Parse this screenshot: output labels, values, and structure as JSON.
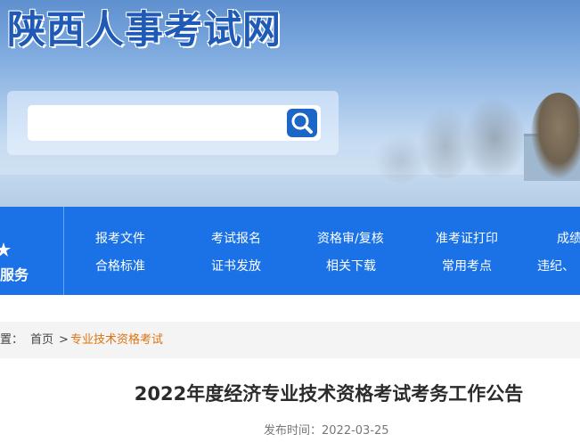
{
  "site": {
    "logo_text": "陕西人事考试网"
  },
  "search": {
    "placeholder": "",
    "button_icon": "magnifier-icon"
  },
  "nav": {
    "left_label": "服务",
    "row1": [
      "报考文件",
      "考试报名",
      "资格审/复核",
      "准考证打印",
      "成绩"
    ],
    "row2": [
      "合格标准",
      "证书发放",
      "相关下载",
      "常用考点",
      "违纪、"
    ]
  },
  "breadcrumb": {
    "prefix": "置：",
    "home": "首页",
    "separator": ">",
    "current": "专业技术资格考试"
  },
  "article": {
    "title": "2022年度经济专业技术资格考试考务工作公告",
    "publish_label": "发布时间：",
    "publish_date": "2022-03-25"
  },
  "colors": {
    "nav_bg": "#1a72e6",
    "logo": "#1f5ab6",
    "breadcrumb_current": "#e0730f",
    "search_button": "#1b66c7"
  }
}
